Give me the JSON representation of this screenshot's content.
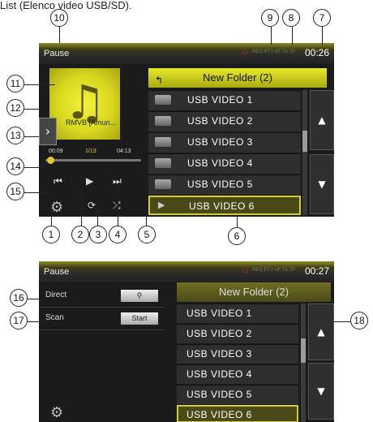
{
  "header_text": "List (Elenco video USB/SD).",
  "callouts": [
    "10",
    "9",
    "8",
    "7",
    "11",
    "12",
    "13",
    "14",
    "15",
    "1",
    "2",
    "3",
    "4",
    "5",
    "6",
    "16",
    "17",
    "18"
  ],
  "screen1": {
    "title": "Pause",
    "time": "00:26",
    "album_caption": "RMVB [Amuri...",
    "track": "1/13",
    "elapsed": "00:09",
    "duration": "04:13",
    "progress": 0.04,
    "folder": "New Folder (2)",
    "items": [
      "USB VIDEO 1",
      "USB VIDEO 2",
      "USB VIDEO 3",
      "USB VIDEO 4",
      "USB VIDEO 5",
      "USB VIDEO 6"
    ],
    "selected_index": 5,
    "icons": [
      "prev-track-icon",
      "play-icon",
      "next-track-icon",
      "settings-gear-icon",
      "repeat-icon",
      "shuffle-icon"
    ]
  },
  "screen2": {
    "title": "Pause",
    "time": "00:27",
    "folder": "New Folder (2)",
    "direct_label": "Direct",
    "scan_label": "Scan",
    "scan_button": "Start",
    "items": [
      "USB VIDEO 1",
      "USB VIDEO 2",
      "USB VIDEO 3",
      "USB VIDEO 4",
      "USB VIDEO 5",
      "USB VIDEO 6"
    ]
  },
  "status_indicators": "REG PTY AF TA TP",
  "colors": {
    "accent": "#d6cf22",
    "bg": "#1b1b1b",
    "row": "#2e2e2e"
  }
}
